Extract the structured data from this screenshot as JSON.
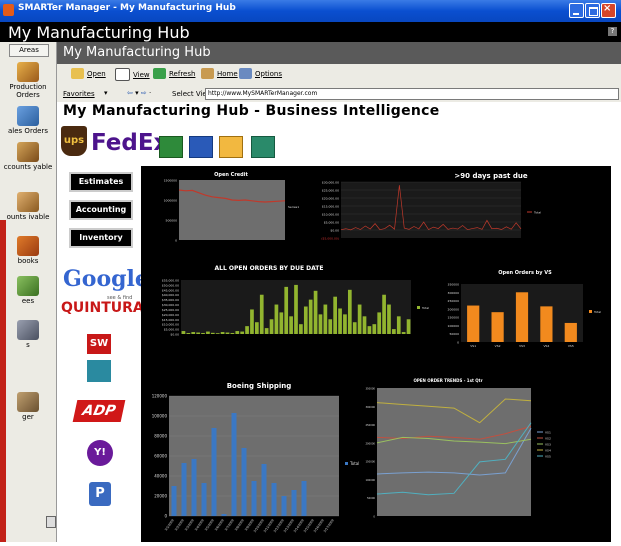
{
  "window": {
    "title": "SMARTer Manager - My Manufacturing Hub"
  },
  "hub": {
    "title": "My Manufacturing Hub",
    "help": "?"
  },
  "left_pane": {
    "areas_label": "Areas",
    "items": [
      {
        "label": "Production Orders"
      },
      {
        "label": "ales Orders"
      },
      {
        "label": "ccounts yable"
      },
      {
        "label": "ounts ivable"
      },
      {
        "label": "books"
      },
      {
        "label": "ees"
      },
      {
        "label": "s"
      },
      {
        "label": "ger"
      }
    ]
  },
  "content_header": {
    "title": "My Manufacturing Hub"
  },
  "toolbar": {
    "open": "Open",
    "view": "View",
    "refresh": "Refresh",
    "home": "Home",
    "options": "Options"
  },
  "address": {
    "favorites": "Favorites",
    "select_view": "Select View",
    "url": "http://www.MySMARTerManager.com"
  },
  "page": {
    "title": "My Manufacturing Hub - Business Intelligence",
    "logos": {
      "ups": "ups",
      "fedex": "FedEx",
      "google": "Google",
      "quintura": "QUINTURA",
      "quintura_tag": "see & find",
      "sw": "SW",
      "adp": "ADP",
      "yahoo": "Y!",
      "p": "P"
    },
    "buttons": {
      "estimates": "Estimates",
      "accounting": "Accounting",
      "inventory": "Inventory"
    }
  },
  "colors": {
    "accent_red": "#c22118",
    "chart_bg": "#000000",
    "plot_gray": "#7f7f7f",
    "bar_green": "#92b52f",
    "bar_orange": "#f28a1e",
    "bar_blue": "#3b78c4"
  },
  "chart_data": [
    {
      "type": "line",
      "title": "Open Credit",
      "legend": [
        "Series1"
      ],
      "yticks": [
        "1500000",
        "1000000",
        "500000",
        "0"
      ],
      "values": [
        1250000,
        1230000,
        1240000,
        1180000,
        1120000,
        1080000,
        1060000,
        1040000,
        1000000,
        990000,
        1000000,
        980000,
        960000,
        950000,
        960000,
        970000,
        980000
      ]
    },
    {
      "type": "line",
      "title": ">90 days past due",
      "legend": [
        "Total"
      ],
      "yticks": [
        "$30,000.00",
        "$25,000.00",
        "$20,000.00",
        "$15,000.00",
        "$10,000.00",
        "$5,000.00",
        "$0.00",
        "($5,000.00)"
      ],
      "values": [
        200,
        800,
        100,
        1500,
        300,
        2500,
        600,
        4000,
        200,
        900,
        3000,
        500,
        28000,
        1200,
        400,
        2200,
        700,
        5000,
        300,
        1800,
        900,
        3500,
        400,
        1200,
        600,
        2800,
        200,
        900,
        1500,
        400,
        6000,
        800,
        1100,
        300,
        2000,
        500,
        4500,
        700
      ]
    },
    {
      "type": "bar",
      "title": "ALL OPEN ORDERS BY DUE DATE",
      "legend": [
        "Total"
      ],
      "yticks": [
        "$55,000.00",
        "$50,000.00",
        "$45,000.00",
        "$40,000.00",
        "$35,000.00",
        "$30,000.00",
        "$25,000.00",
        "$20,000.00",
        "$15,000.00",
        "$10,000.00",
        "$5,000.00",
        "$0.00"
      ],
      "values": [
        3000,
        1000,
        2000,
        1500,
        1000,
        2500,
        1200,
        800,
        2000,
        1500,
        1000,
        3000,
        2500,
        8000,
        25000,
        12000,
        40000,
        6000,
        15000,
        30000,
        22000,
        48000,
        18000,
        50000,
        10000,
        28000,
        35000,
        44000,
        20000,
        30000,
        15000,
        38000,
        26000,
        20000,
        45000,
        12000,
        30000,
        18000,
        8000,
        10000,
        22000,
        40000,
        30000,
        5000,
        18000,
        2000,
        15000
      ]
    },
    {
      "type": "bar",
      "title": "Open Orders by VS",
      "legend": [
        "Total"
      ],
      "categories": [
        "VS1",
        "VS2",
        "VS3",
        "VS4",
        "VS5"
      ],
      "yticks": [
        "350000",
        "300000",
        "250000",
        "200000",
        "150000",
        "100000",
        "50000",
        "0"
      ],
      "values": [
        220000,
        180000,
        300000,
        215000,
        115000
      ]
    },
    {
      "type": "bar",
      "title": "Boeing Shipping",
      "legend": [
        "Total"
      ],
      "categories": [
        "3/1/2009",
        "3/2/2009",
        "3/3/2009",
        "3/4/2009",
        "3/5/2009",
        "3/6/2009",
        "3/7/2009",
        "3/8/2009",
        "3/9/2009",
        "3/10/2009",
        "3/11/2009",
        "3/12/2009",
        "3/13/2009",
        "3/14/2009",
        "3/15/2009",
        "3/16/2009",
        "3/17/2009"
      ],
      "yticks": [
        "120000",
        "100000",
        "80000",
        "60000",
        "40000",
        "20000",
        "0"
      ],
      "values": [
        30000,
        53000,
        57000,
        33000,
        88000,
        2000,
        103000,
        68000,
        35000,
        52000,
        33000,
        20000,
        26000,
        35000,
        0,
        0,
        0
      ]
    },
    {
      "type": "line",
      "title": "OPEN ORDER TRENDS - 1st Qtr",
      "legend": [
        "VS1",
        "VS2",
        "VS3",
        "VS4",
        "VS5"
      ],
      "series": [
        {
          "name": "VS1",
          "values": [
            115000,
            118000,
            120000,
            118000,
            112000,
            118000,
            240000
          ]
        },
        {
          "name": "VS2",
          "values": [
            215000,
            212000,
            218000,
            215000,
            210000,
            225000,
            245000
          ]
        },
        {
          "name": "VS3",
          "values": [
            200000,
            215000,
            212000,
            205000,
            202000,
            198000,
            210000
          ]
        },
        {
          "name": "VS4",
          "values": [
            310000,
            305000,
            300000,
            295000,
            255000,
            320000,
            315000
          ]
        },
        {
          "name": "VS5",
          "values": [
            60000,
            65000,
            58000,
            62000,
            148000,
            155000,
            255000
          ]
        }
      ]
    }
  ]
}
